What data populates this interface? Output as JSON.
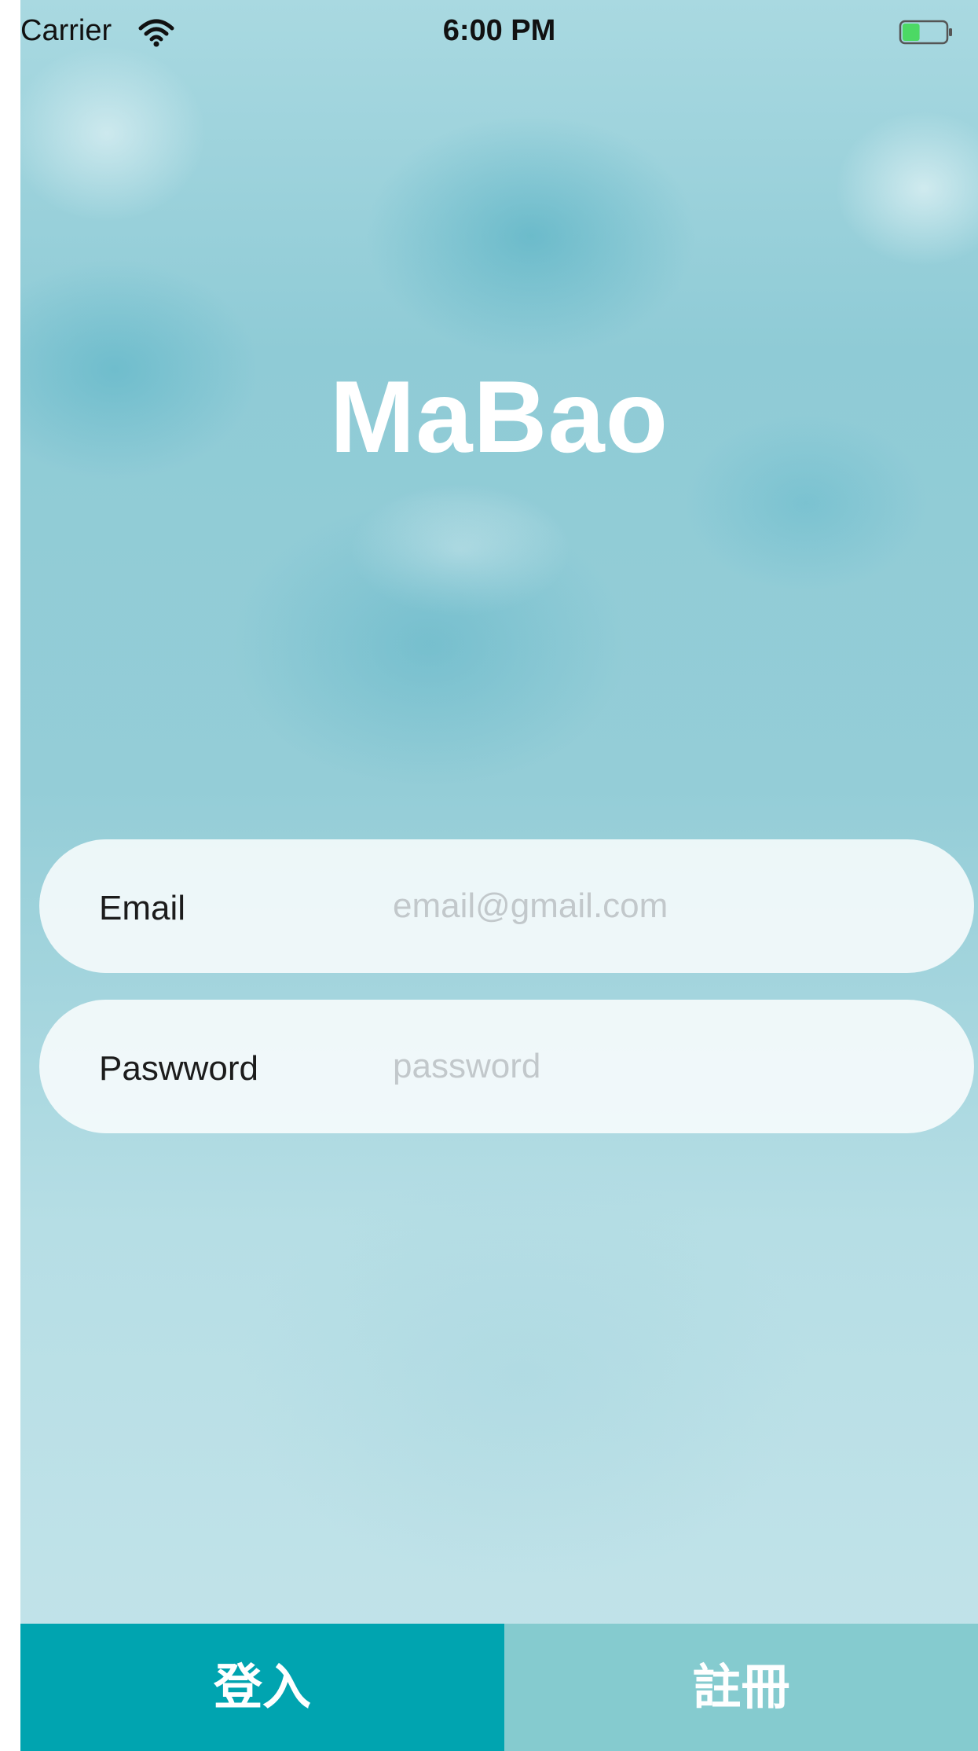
{
  "status_bar": {
    "carrier": "Carrier",
    "time": "6:00 PM",
    "icons": [
      "wifi-icon",
      "battery-icon"
    ],
    "battery_level": 0.4,
    "battery_color": "#4cd964"
  },
  "app": {
    "title": "MaBao"
  },
  "form": {
    "email": {
      "label": "Email",
      "placeholder": "email@gmail.com",
      "value": ""
    },
    "password": {
      "label": "Paswword",
      "placeholder": "password",
      "value": ""
    }
  },
  "actions": {
    "login_label": "登入",
    "register_label": "註冊"
  },
  "colors": {
    "login_button": "#00a4b0",
    "register_button": "#85cbcf"
  }
}
